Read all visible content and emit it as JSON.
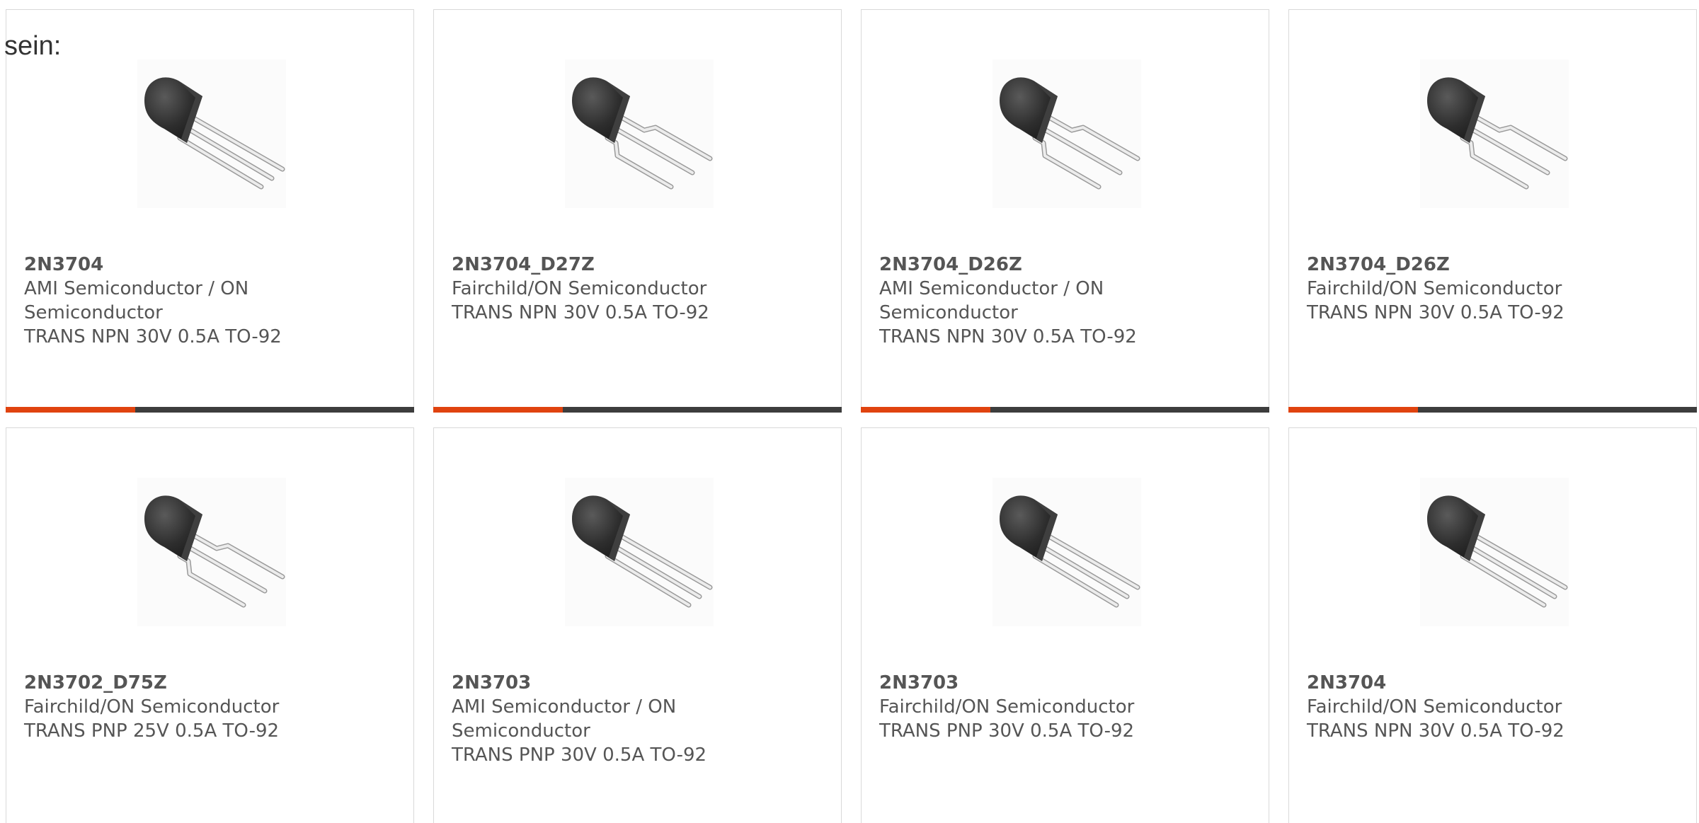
{
  "intro_text": "sein:",
  "colors": {
    "accent": "#e0430f",
    "bar": "#3d3d3d",
    "text": "#555555"
  },
  "products": [
    {
      "part": "2N3704",
      "manufacturer": "AMI Semiconductor / ON Semiconductor",
      "description": "TRANS NPN 30V 0.5A TO-92",
      "image": "to-92-transistor-image"
    },
    {
      "part": "2N3704_D27Z",
      "manufacturer": "Fairchild/ON Semiconductor",
      "description": "TRANS NPN 30V 0.5A TO-92",
      "image": "to-92-transistor-bent-leads-image"
    },
    {
      "part": "2N3704_D26Z",
      "manufacturer": "AMI Semiconductor / ON Semiconductor",
      "description": "TRANS NPN 30V 0.5A TO-92",
      "image": "to-92-transistor-bent-leads-image"
    },
    {
      "part": "2N3704_D26Z",
      "manufacturer": "Fairchild/ON Semiconductor",
      "description": "TRANS NPN 30V 0.5A TO-92",
      "image": "to-92-transistor-bent-leads-image"
    },
    {
      "part": "2N3702_D75Z",
      "manufacturer": "Fairchild/ON Semiconductor",
      "description": "TRANS PNP 25V 0.5A TO-92",
      "image": "to-92-transistor-bent-leads-image"
    },
    {
      "part": "2N3703",
      "manufacturer": "AMI Semiconductor / ON Semiconductor",
      "description": "TRANS PNP 30V 0.5A TO-92",
      "image": "to-92-transistor-image"
    },
    {
      "part": "2N3703",
      "manufacturer": "Fairchild/ON Semiconductor",
      "description": "TRANS PNP 30V 0.5A TO-92",
      "image": "to-92-transistor-image"
    },
    {
      "part": "2N3704",
      "manufacturer": "Fairchild/ON Semiconductor",
      "description": "TRANS NPN 30V 0.5A TO-92",
      "image": "to-92-transistor-image"
    }
  ]
}
